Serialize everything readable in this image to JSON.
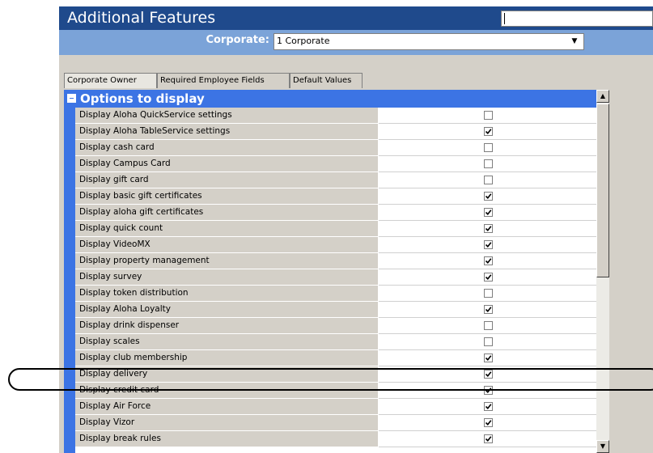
{
  "window": {
    "title": "Additional Features",
    "title_input_value": ""
  },
  "corporate": {
    "label": "Corporate:",
    "value": "1 Corporate"
  },
  "tabs": [
    {
      "label": "Corporate Owner",
      "active": true
    },
    {
      "label": "Required Employee Fields",
      "active": false
    },
    {
      "label": "Default Values",
      "active": false
    }
  ],
  "grid": {
    "section_title": "Options to display",
    "rows": [
      {
        "label": "Display Aloha QuickService settings",
        "checked": false
      },
      {
        "label": "Display Aloha TableService settings",
        "checked": true
      },
      {
        "label": "Display cash card",
        "checked": false
      },
      {
        "label": "Display Campus Card",
        "checked": false
      },
      {
        "label": "Display gift card",
        "checked": false
      },
      {
        "label": "Display basic gift certificates",
        "checked": true
      },
      {
        "label": "Display aloha gift certificates",
        "checked": true
      },
      {
        "label": "Display quick count",
        "checked": true
      },
      {
        "label": "Display VideoMX",
        "checked": true
      },
      {
        "label": "Display property management",
        "checked": true
      },
      {
        "label": "Display survey",
        "checked": true
      },
      {
        "label": "Display token distribution",
        "checked": false
      },
      {
        "label": "Display Aloha Loyalty",
        "checked": true
      },
      {
        "label": "Display drink dispenser",
        "checked": false
      },
      {
        "label": "Display scales",
        "checked": false
      },
      {
        "label": "Display club membership",
        "checked": true
      },
      {
        "label": "Display delivery",
        "checked": true
      },
      {
        "label": "Display credit card",
        "checked": true
      },
      {
        "label": "Display Air Force",
        "checked": true
      },
      {
        "label": "Display Vizor",
        "checked": true
      },
      {
        "label": "Display break rules",
        "checked": true
      }
    ]
  },
  "colors": {
    "title_bar": "#1f4a8c",
    "corporate_bar": "#7ba3d8",
    "section_header": "#3c74e4",
    "label_cell": "#d4d0c8"
  },
  "icons": {
    "collapse": "minus-box-icon",
    "dropdown": "chevron-down-icon",
    "scroll_up": "arrow-up-icon",
    "scroll_down": "arrow-down-icon",
    "check": "checkmark-icon"
  },
  "annotation": {
    "highlighted_row": "Display delivery"
  }
}
